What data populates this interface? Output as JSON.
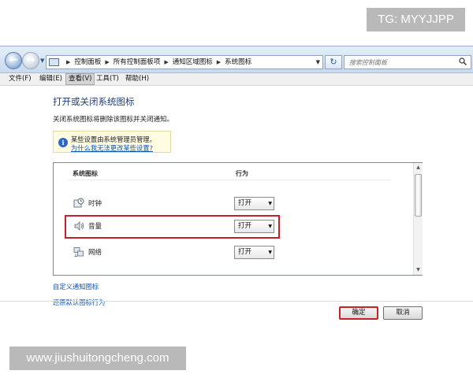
{
  "watermarks": {
    "top": "TG: MYYJJPP",
    "bottom": "www.jiushuitongcheng.com"
  },
  "address": {
    "crumbs": [
      "控制面板",
      "所有控制面板项",
      "通知区域图标",
      "系统图标"
    ],
    "search_placeholder": "搜索控制面板"
  },
  "menu": [
    {
      "label": "文件(F)",
      "active": false
    },
    {
      "label": "编辑(E)",
      "active": false
    },
    {
      "label": "查看(V)",
      "active": true
    },
    {
      "label": "工具(T)",
      "active": false
    },
    {
      "label": "帮助(H)",
      "active": false
    }
  ],
  "page": {
    "title": "打开或关闭系统图标",
    "subtitle": "关闭系统图标将删除该图标并关闭通知。",
    "info_text": "某些设置由系统管理员管理。",
    "info_link": "为什么我无法更改某些设置?"
  },
  "table": {
    "col_icon": "系统图标",
    "col_behavior": "行为",
    "rows": [
      {
        "label": "时钟",
        "icon": "clock-icon",
        "value": "打开"
      },
      {
        "label": "音量",
        "icon": "volume-icon",
        "value": "打开",
        "highlighted": true
      },
      {
        "label": "网络",
        "icon": "network-icon",
        "value": "打开"
      }
    ]
  },
  "links": {
    "customize": "自定义通知图标",
    "restore": "还原默认图标行为"
  },
  "buttons": {
    "ok": "确定",
    "cancel": "取消"
  },
  "colors": {
    "title": "#1e3e78",
    "link": "#0d56b6",
    "highlight": "#c2222a",
    "info_bg": "#fffce1"
  }
}
